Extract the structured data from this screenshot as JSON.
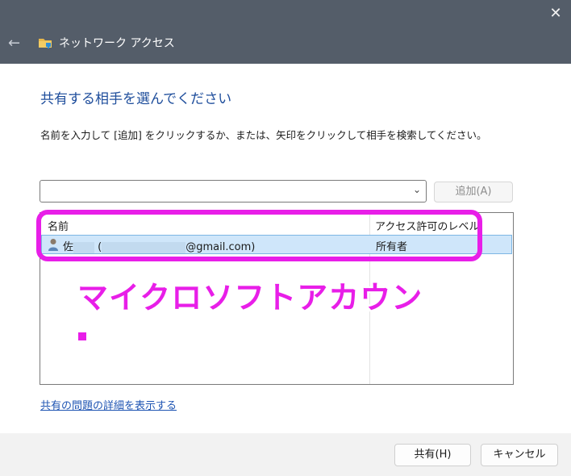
{
  "window": {
    "title": "ネットワーク アクセス",
    "back_icon": "←",
    "close_icon": "✕"
  },
  "main": {
    "heading": "共有する相手を選んでください",
    "description": "名前を入力して [追加] をクリックするか、または、矢印をクリックして相手を検索してください。",
    "input_value": "",
    "add_button": "追加(A)"
  },
  "list": {
    "columns": [
      "名前",
      "アクセス許可のレベル"
    ],
    "rows": [
      {
        "name_prefix": "佐",
        "name_open": "(",
        "name_suffix": "@gmail.com)",
        "permission": "所有者"
      }
    ]
  },
  "overlay": {
    "text": "マイクロソフトアカウン",
    "color": "#e81ee8"
  },
  "link": "共有の問題の詳細を表示する",
  "footer": {
    "share_button": "共有(H)",
    "cancel_button": "キャンセル"
  }
}
